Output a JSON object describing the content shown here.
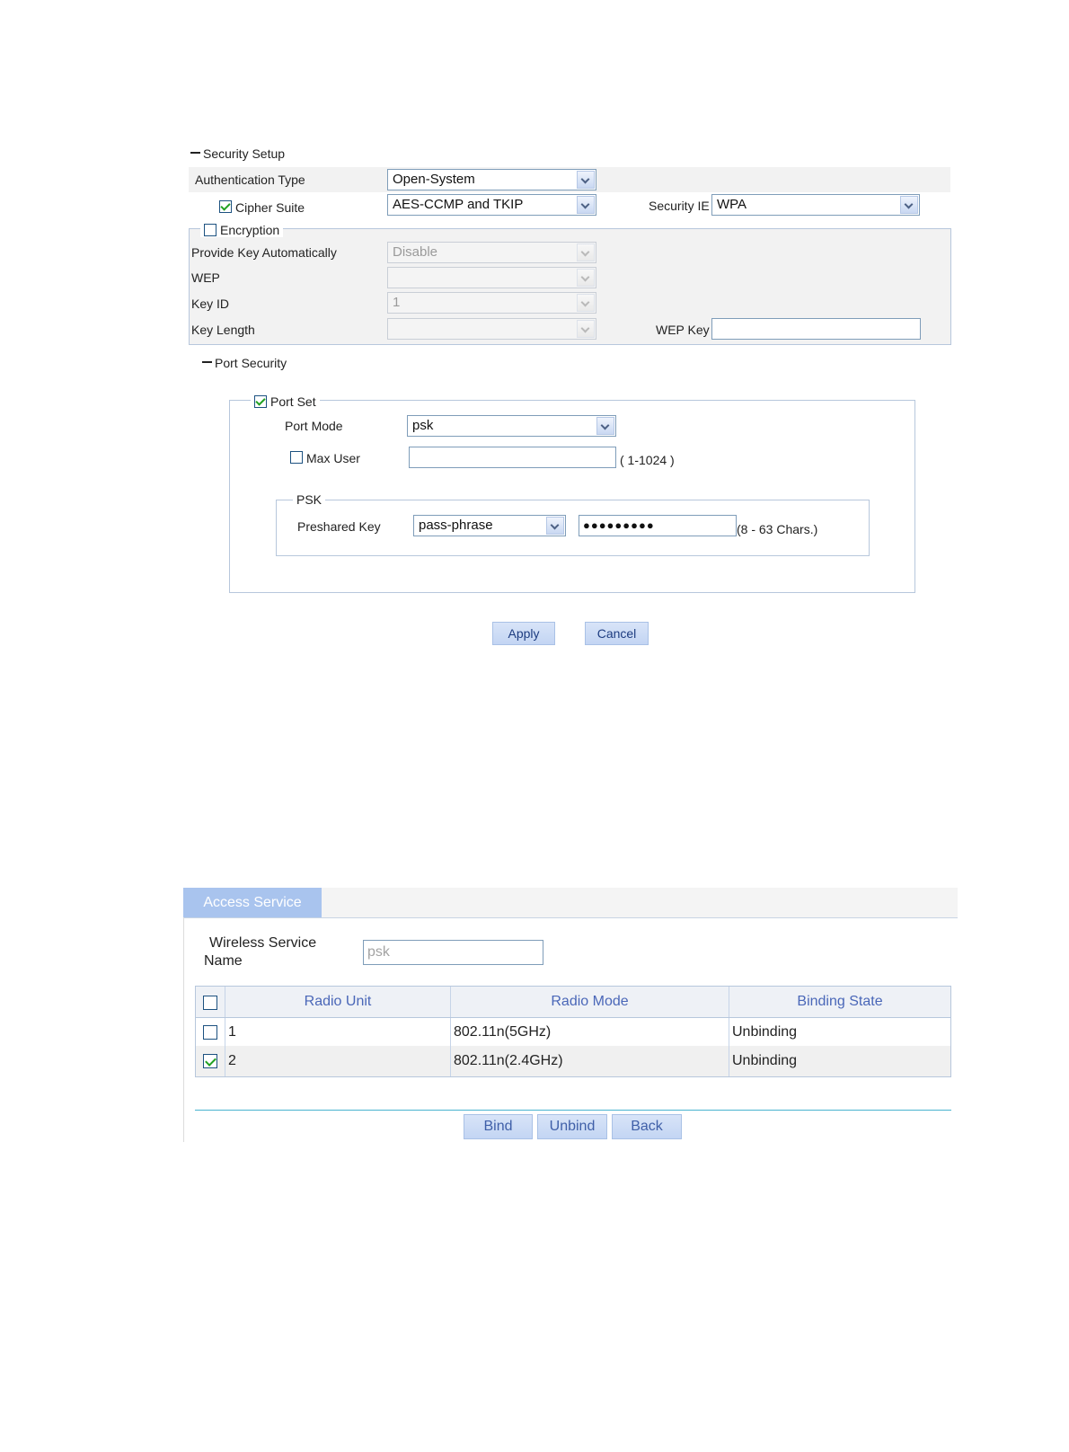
{
  "security_setup": {
    "section_title": "Security Setup",
    "authentication_type_label": "Authentication Type",
    "authentication_type_value": "Open-System",
    "cipher_suite_label": "Cipher Suite",
    "cipher_suite_checked": true,
    "cipher_suite_value": "AES-CCMP and TKIP",
    "security_ie_label": "Security IE",
    "security_ie_value": "WPA",
    "encryption": {
      "legend": "Encryption",
      "checked": false,
      "provide_key_label": "Provide Key Automatically",
      "provide_key_value": "Disable",
      "wep_label": "WEP",
      "wep_value": "",
      "key_id_label": "Key ID",
      "key_id_value": "1",
      "key_length_label": "Key Length",
      "key_length_value": "",
      "wep_key_label": "WEP Key",
      "wep_key_value": ""
    }
  },
  "port_security": {
    "section_title": "Port Security",
    "port_set_legend": "Port Set",
    "port_set_checked": true,
    "port_mode_label": "Port Mode",
    "port_mode_value": "psk",
    "max_user_label": "Max User",
    "max_user_checked": false,
    "max_user_value": "",
    "max_user_hint": "( 1-1024 )",
    "psk": {
      "legend": "PSK",
      "preshared_key_label": "Preshared Key",
      "preshared_key_type": "pass-phrase",
      "preshared_key_value": "●●●●●●●●●",
      "preshared_key_hint": "(8 - 63 Chars.)"
    },
    "apply_label": "Apply",
    "cancel_label": "Cancel"
  },
  "access_service": {
    "tab_label": "Access Service",
    "wireless_service_label_line1": "Wireless Service",
    "wireless_service_label_line2": "Name",
    "wireless_service_value": "psk",
    "table": {
      "columns": [
        "Radio Unit",
        "Radio Mode",
        "Binding State"
      ],
      "rows": [
        {
          "checked": false,
          "radio_unit": "1",
          "radio_mode": "802.11n(5GHz)",
          "binding_state": "Unbinding"
        },
        {
          "checked": true,
          "radio_unit": "2",
          "radio_mode": "802.11n(2.4GHz)",
          "binding_state": "Unbinding"
        }
      ]
    },
    "bind_label": "Bind",
    "unbind_label": "Unbind",
    "back_label": "Back"
  },
  "colors": {
    "accent": "#4a67b8",
    "tab_background": "#a9c4ee",
    "button_background": "#c3d5f3",
    "divider": "#49b3cf"
  }
}
